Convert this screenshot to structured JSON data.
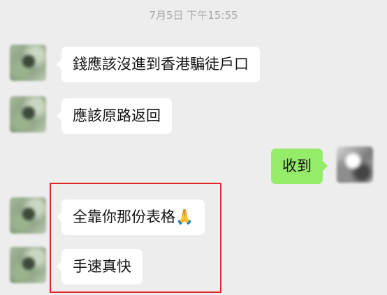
{
  "chat": {
    "timestamp": "7月5日 下午15:55",
    "messages": [
      {
        "sender": "friend",
        "text": "錢應該沒進到香港騙徒戶口"
      },
      {
        "sender": "friend",
        "text": "應該原路返回"
      },
      {
        "sender": "self",
        "text": "收到"
      },
      {
        "sender": "friend",
        "text": "全靠你那份表格🙏"
      },
      {
        "sender": "friend",
        "text": "手速真快"
      }
    ]
  },
  "colors": {
    "background": "#ededed",
    "incoming_bubble": "#ffffff",
    "outgoing_bubble": "#95ec69",
    "timestamp_text": "#a9a9a9",
    "highlight_border": "#e42323"
  },
  "icons": {
    "avatar_friend": "blurred-avatar",
    "avatar_self": "blurred-avatar"
  }
}
